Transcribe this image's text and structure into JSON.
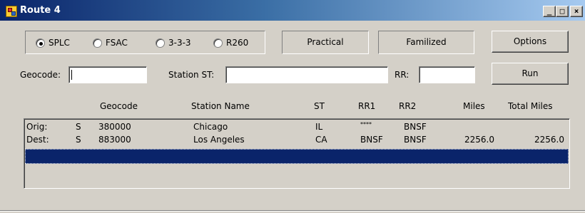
{
  "window": {
    "title": "Route 4",
    "minimize": "_",
    "maximize": "□",
    "close": "×"
  },
  "routing": {
    "options": [
      {
        "label": "SPLC",
        "selected": true
      },
      {
        "label": "FSAC",
        "selected": false
      },
      {
        "label": "3-3-3",
        "selected": false
      },
      {
        "label": "R260",
        "selected": false
      }
    ],
    "practical_label": "Practical",
    "familized_label": "Familized",
    "options_button": "Options",
    "run_button": "Run"
  },
  "form": {
    "geocode_label": "Geocode:",
    "geocode_value": "",
    "station_label": "Station ST:",
    "station_value": "",
    "rr_label": "RR:",
    "rr_value": ""
  },
  "table": {
    "headers": [
      "Geocode",
      "Station Name",
      "ST",
      "RR1",
      "RR2",
      "Miles",
      "Total Miles"
    ],
    "rows": [
      {
        "type": "Orig:",
        "code": "S",
        "geocode": "380000",
        "station": "Chicago",
        "st": "IL",
        "rr1": "****",
        "rr2": "BNSF",
        "miles": "",
        "total": ""
      },
      {
        "type": "Dest:",
        "code": "S",
        "geocode": "883000",
        "station": "Los Angeles",
        "st": "CA",
        "rr1": "BNSF",
        "rr2": "BNSF",
        "miles": "2256.0",
        "total": "2256.0"
      }
    ]
  },
  "colors": {
    "titlebar": "#0a246a",
    "selection": "#0a246a",
    "face": "#d4d0c8"
  }
}
